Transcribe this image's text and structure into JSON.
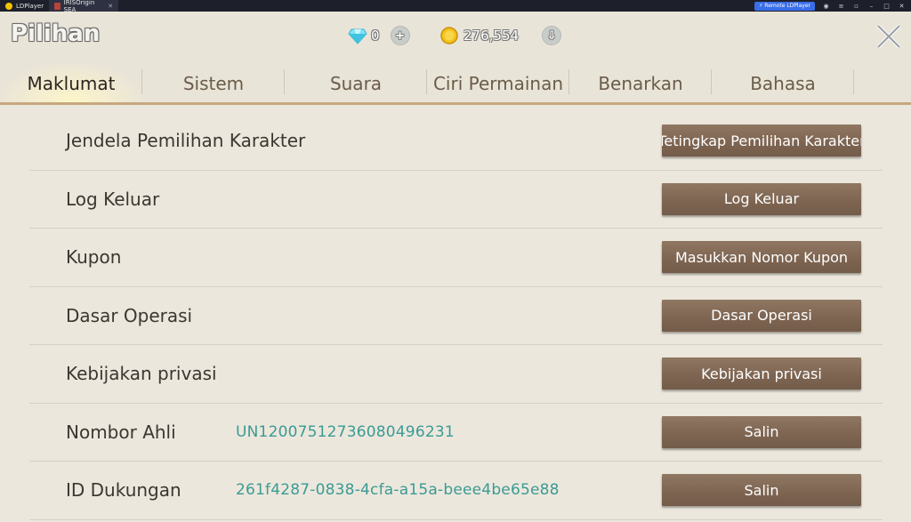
{
  "titlebar": {
    "app_tab": "LDPlayer",
    "game_tab": "IRISOrigin SEA",
    "remote_label": "Remote LDPlayer"
  },
  "header": {
    "title": "Pilihan",
    "diamond_count": "0",
    "gold_count": "276,554"
  },
  "tabs": [
    {
      "label": "Maklumat",
      "active": true
    },
    {
      "label": "Sistem",
      "active": false
    },
    {
      "label": "Suara",
      "active": false
    },
    {
      "label": "Ciri Permainan",
      "active": false
    },
    {
      "label": "Benarkan",
      "active": false
    },
    {
      "label": "Bahasa",
      "active": false
    }
  ],
  "rows": [
    {
      "label": "Jendela Pemilihan Karakter",
      "value": "",
      "button": "Tetingkap Pemilihan Karakter"
    },
    {
      "label": "Log Keluar",
      "value": "",
      "button": "Log Keluar"
    },
    {
      "label": "Kupon",
      "value": "",
      "button": "Masukkan Nomor Kupon"
    },
    {
      "label": "Dasar Operasi",
      "value": "",
      "button": "Dasar Operasi"
    },
    {
      "label": "Kebijakan privasi",
      "value": "",
      "button": "Kebijakan privasi"
    },
    {
      "label": "Nombor Ahli",
      "value": "UN12007512736080496231",
      "button": "Salin"
    },
    {
      "label": "ID Dukungan",
      "value": "261f4287-0838-4cfa-a15a-beee4be65e88",
      "button": "Salin"
    }
  ],
  "colors": {
    "accent_teal": "#3a9b95",
    "button_brown": "#7d6451",
    "tab_rule": "#c7a780",
    "background": "#ece7dc"
  }
}
